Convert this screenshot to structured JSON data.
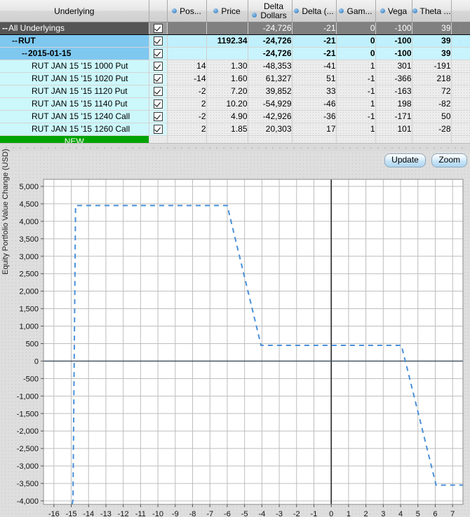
{
  "table": {
    "columns": [
      {
        "label": "Underlying",
        "sortable": false,
        "align": "center"
      },
      {
        "label": "",
        "sortable": false,
        "align": "center"
      },
      {
        "label": "Pos...",
        "sortable": true,
        "align": "center"
      },
      {
        "label": "Price",
        "sortable": true,
        "align": "center"
      },
      {
        "label": "Delta Dollars",
        "sortable": true,
        "align": "center"
      },
      {
        "label": "Delta (...",
        "sortable": true,
        "align": "center"
      },
      {
        "label": "Gam...",
        "sortable": true,
        "align": "center"
      },
      {
        "label": "Vega",
        "sortable": true,
        "align": "center"
      },
      {
        "label": "Theta ...",
        "sortable": true,
        "align": "center"
      }
    ],
    "rows": [
      {
        "expander": "--",
        "indent": 0,
        "name": "All Underlyings",
        "checked": true,
        "pos": "",
        "price": "",
        "delta_dollars": "-24,726",
        "delta": "-21",
        "gamma": "0",
        "vega": "-100",
        "theta": "39",
        "style": "row-all"
      },
      {
        "expander": "--",
        "indent": 1,
        "name": "RUT",
        "checked": true,
        "pos": "",
        "price": "1192.34",
        "delta_dollars": "-24,726",
        "delta": "-21",
        "gamma": "0",
        "vega": "-100",
        "theta": "39",
        "style": "row-sel"
      },
      {
        "expander": "--",
        "indent": 2,
        "name": "2015-01-15",
        "checked": true,
        "pos": "",
        "price": "",
        "delta_dollars": "-24,726",
        "delta": "-21",
        "gamma": "0",
        "vega": "-100",
        "theta": "39",
        "style": "row-sel2"
      },
      {
        "expander": "",
        "indent": 3,
        "name": "RUT JAN 15 '15 1000 Put",
        "checked": true,
        "pos": "14",
        "price": "1.30",
        "delta_dollars": "-48,353",
        "delta": "-41",
        "gamma": "1",
        "vega": "301",
        "theta": "-191",
        "style": "row-leaf"
      },
      {
        "expander": "",
        "indent": 3,
        "name": "RUT JAN 15 '15 1020 Put",
        "checked": true,
        "pos": "-14",
        "price": "1.60",
        "delta_dollars": "61,327",
        "delta": "51",
        "gamma": "-1",
        "vega": "-366",
        "theta": "218",
        "style": "row-leaf"
      },
      {
        "expander": "",
        "indent": 3,
        "name": "RUT JAN 15 '15 1120 Put",
        "checked": true,
        "pos": "-2",
        "price": "7.20",
        "delta_dollars": "39,852",
        "delta": "33",
        "gamma": "-1",
        "vega": "-163",
        "theta": "72",
        "style": "row-leaf"
      },
      {
        "expander": "",
        "indent": 3,
        "name": "RUT JAN 15 '15 1140 Put",
        "checked": true,
        "pos": "2",
        "price": "10.20",
        "delta_dollars": "-54,929",
        "delta": "-46",
        "gamma": "1",
        "vega": "198",
        "theta": "-82",
        "style": "row-leaf"
      },
      {
        "expander": "",
        "indent": 3,
        "name": "RUT JAN 15 '15 1240 Call",
        "checked": true,
        "pos": "-2",
        "price": "4.90",
        "delta_dollars": "-42,926",
        "delta": "-36",
        "gamma": "-1",
        "vega": "-171",
        "theta": "50",
        "style": "row-leaf"
      },
      {
        "expander": "",
        "indent": 3,
        "name": "RUT JAN 15 '15 1260 Call",
        "checked": true,
        "pos": "2",
        "price": "1.85",
        "delta_dollars": "20,303",
        "delta": "17",
        "gamma": "1",
        "vega": "101",
        "theta": "-28",
        "style": "row-leaf"
      }
    ],
    "new_row_label": "NEW"
  },
  "toolbar": {
    "update_label": "Update",
    "zoom_label": "Zoom"
  },
  "chart_data": {
    "type": "line",
    "title": "",
    "xlabel": "",
    "ylabel": "Equity Portfolio Value Change (USD)",
    "xlim": [
      -16.6,
      7.6
    ],
    "ylim": [
      -4100,
      5200
    ],
    "xticks": [
      -16,
      -15,
      -14,
      -13,
      -12,
      -11,
      -10,
      -9,
      -8,
      -7,
      -6,
      -5,
      -4,
      -3,
      -2,
      -1,
      0,
      1,
      2,
      3,
      4,
      5,
      6,
      7
    ],
    "yticks": [
      5000,
      4500,
      4000,
      3500,
      3000,
      2500,
      2000,
      1500,
      1000,
      500,
      0,
      -500,
      -1000,
      -1500,
      -2000,
      -2500,
      -3000,
      -3500,
      -4000
    ],
    "ytick_labels": [
      "5,000",
      "4,500",
      "4,000",
      "3,500",
      "3,000",
      "2,500",
      "2,000",
      "1,500",
      "1,000",
      "500",
      "0",
      "-500",
      "-1,000",
      "-1,500",
      "-2,000",
      "-2,500",
      "-3,000",
      "-3,500",
      "-4,000"
    ],
    "grid": true,
    "legend": "none",
    "zero_line_x": 0,
    "zero_line_y": 0,
    "series": [
      {
        "name": "Equity Portfolio Value Change",
        "color": "#4a90d9",
        "style": "dashed",
        "x": [
          -14.95,
          -14.9,
          -14.75,
          -6.0,
          -4.05,
          4.05,
          6.05,
          7.6
        ],
        "y": [
          -4100,
          -3980,
          4450,
          4450,
          450,
          450,
          -3550,
          -3550
        ]
      }
    ]
  }
}
